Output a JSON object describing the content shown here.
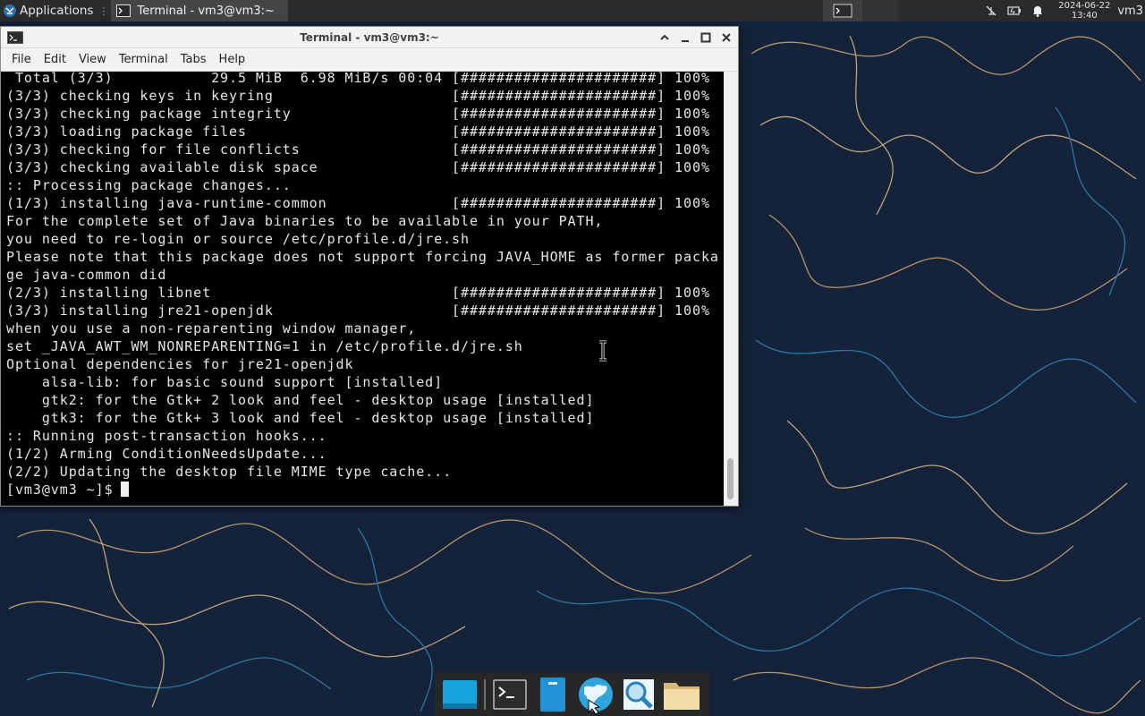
{
  "top_panel": {
    "applications_label": "Applications",
    "taskbar_title": "Terminal - vm3@vm3:~",
    "clock_date": "2024-06-22",
    "clock_time": "13:40",
    "user": "vm3"
  },
  "window": {
    "title": "Terminal - vm3@vm3:~",
    "menu": [
      "File",
      "Edit",
      "View",
      "Terminal",
      "Tabs",
      "Help"
    ]
  },
  "terminal": {
    "lines": [
      " Total (3/3)           29.5 MiB  6.98 MiB/s 00:04 [######################] 100%",
      "(3/3) checking keys in keyring                    [######################] 100%",
      "(3/3) checking package integrity                  [######################] 100%",
      "(3/3) loading package files                       [######################] 100%",
      "(3/3) checking for file conflicts                 [######################] 100%",
      "(3/3) checking available disk space               [######################] 100%",
      ":: Processing package changes...",
      "(1/3) installing java-runtime-common              [######################] 100%",
      "For the complete set of Java binaries to be available in your PATH,",
      "you need to re-login or source /etc/profile.d/jre.sh",
      "Please note that this package does not support forcing JAVA_HOME as former packa",
      "ge java-common did",
      "(2/3) installing libnet                           [######################] 100%",
      "(3/3) installing jre21-openjdk                    [######################] 100%",
      "when you use a non-reparenting window manager,",
      "set _JAVA_AWT_WM_NONREPARENTING=1 in /etc/profile.d/jre.sh",
      "Optional dependencies for jre21-openjdk",
      "    alsa-lib: for basic sound support [installed]",
      "    gtk2: for the Gtk+ 2 look and feel - desktop usage [installed]",
      "    gtk3: for the Gtk+ 3 look and feel - desktop usage [installed]",
      ":: Running post-transaction hooks...",
      "(1/2) Arming ConditionNeedsUpdate...",
      "(2/2) Updating the desktop file MIME type cache..."
    ],
    "prompt": "[vm3@vm3 ~]$"
  },
  "dock": {
    "items": [
      "show-desktop",
      "terminal",
      "file-manager-blue",
      "web-browser",
      "app-finder",
      "home-folder"
    ]
  }
}
